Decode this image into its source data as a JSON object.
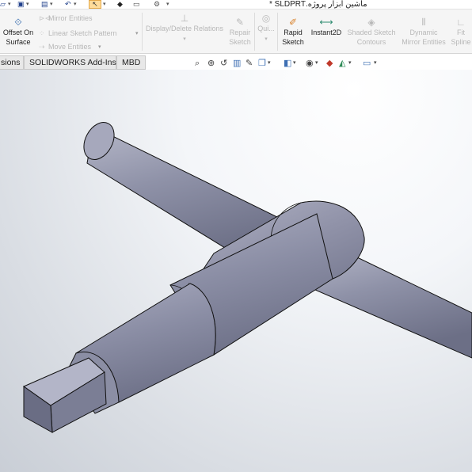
{
  "titlebar": {
    "document_title": "ماشین ابزار پروژه.SLDPRT *"
  },
  "ribbon": {
    "offset_on_surface": [
      "Offset On",
      "Surface"
    ],
    "mirror_entities": "Mirror Entities",
    "linear_sketch_pattern": "Linear Sketch Pattern",
    "move_entities": "Move Entities",
    "display_delete_relations": "Display/Delete Relations",
    "repair_sketch": [
      "Repair",
      "Sketch"
    ],
    "quick_snaps": "Qui...",
    "rapid_sketch": [
      "Rapid",
      "Sketch"
    ],
    "instant2d": "Instant2D",
    "shaded_sketch_contours": [
      "Shaded Sketch",
      "Contours"
    ],
    "dynamic_mirror_entities": [
      "Dynamic",
      "Mirror Entities"
    ],
    "fit_spline": [
      "Fit",
      "Spline"
    ]
  },
  "tabs": [
    {
      "label": "sions"
    },
    {
      "label": "SOLIDWORKS Add-Ins"
    },
    {
      "label": "MBD"
    }
  ],
  "headsup_icons": [
    "zoom-to-fit-icon",
    "zoom-to-area-icon",
    "previous-view-icon",
    "section-view-icon",
    "dynamic-annotation-icon",
    "view-orientation-icon",
    "display-style-icon",
    "hide-show-items-icon",
    "edit-appearance-icon",
    "apply-scene-icon",
    "view-settings-icon"
  ],
  "colors": {
    "select_button": "#ffdc9a",
    "part_body": "#8f92a8",
    "tab_background": "#e8e8e8"
  }
}
